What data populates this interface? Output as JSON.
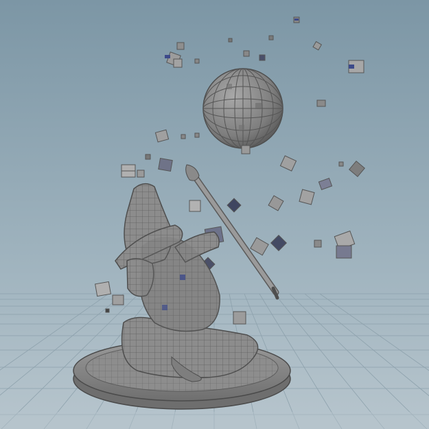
{
  "viewport": {
    "name": "3D Viewport",
    "background_top": "#7e97a6",
    "background_bottom": "#b3c2cb",
    "grid_color": "#8fa3ae",
    "model_color": "#8a8a8a",
    "wire_color": "#5a5a5a",
    "uv_accent": "#3d4a8a"
  }
}
